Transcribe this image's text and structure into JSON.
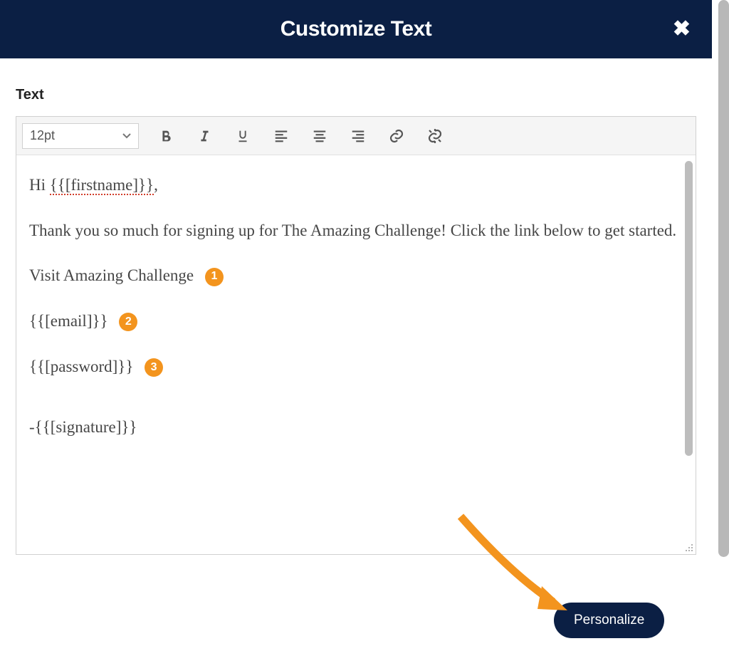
{
  "modal": {
    "title": "Customize Text",
    "label": "Text"
  },
  "toolbar": {
    "font_size": "12pt"
  },
  "content": {
    "greeting_prefix": "Hi ",
    "greeting_token": "{{[firstname]}}",
    "greeting_suffix": ",",
    "body": "Thank you so much for signing up for The Amazing Challenge! Click the link below to get started.",
    "link_text": "Visit Amazing Challenge",
    "email_token": "{{[email]}}",
    "password_token": "{{[password]}}",
    "signature": "-{{[signature]}}"
  },
  "markers": {
    "m1": "1",
    "m2": "2",
    "m3": "3"
  },
  "actions": {
    "personalize": "Personalize"
  }
}
